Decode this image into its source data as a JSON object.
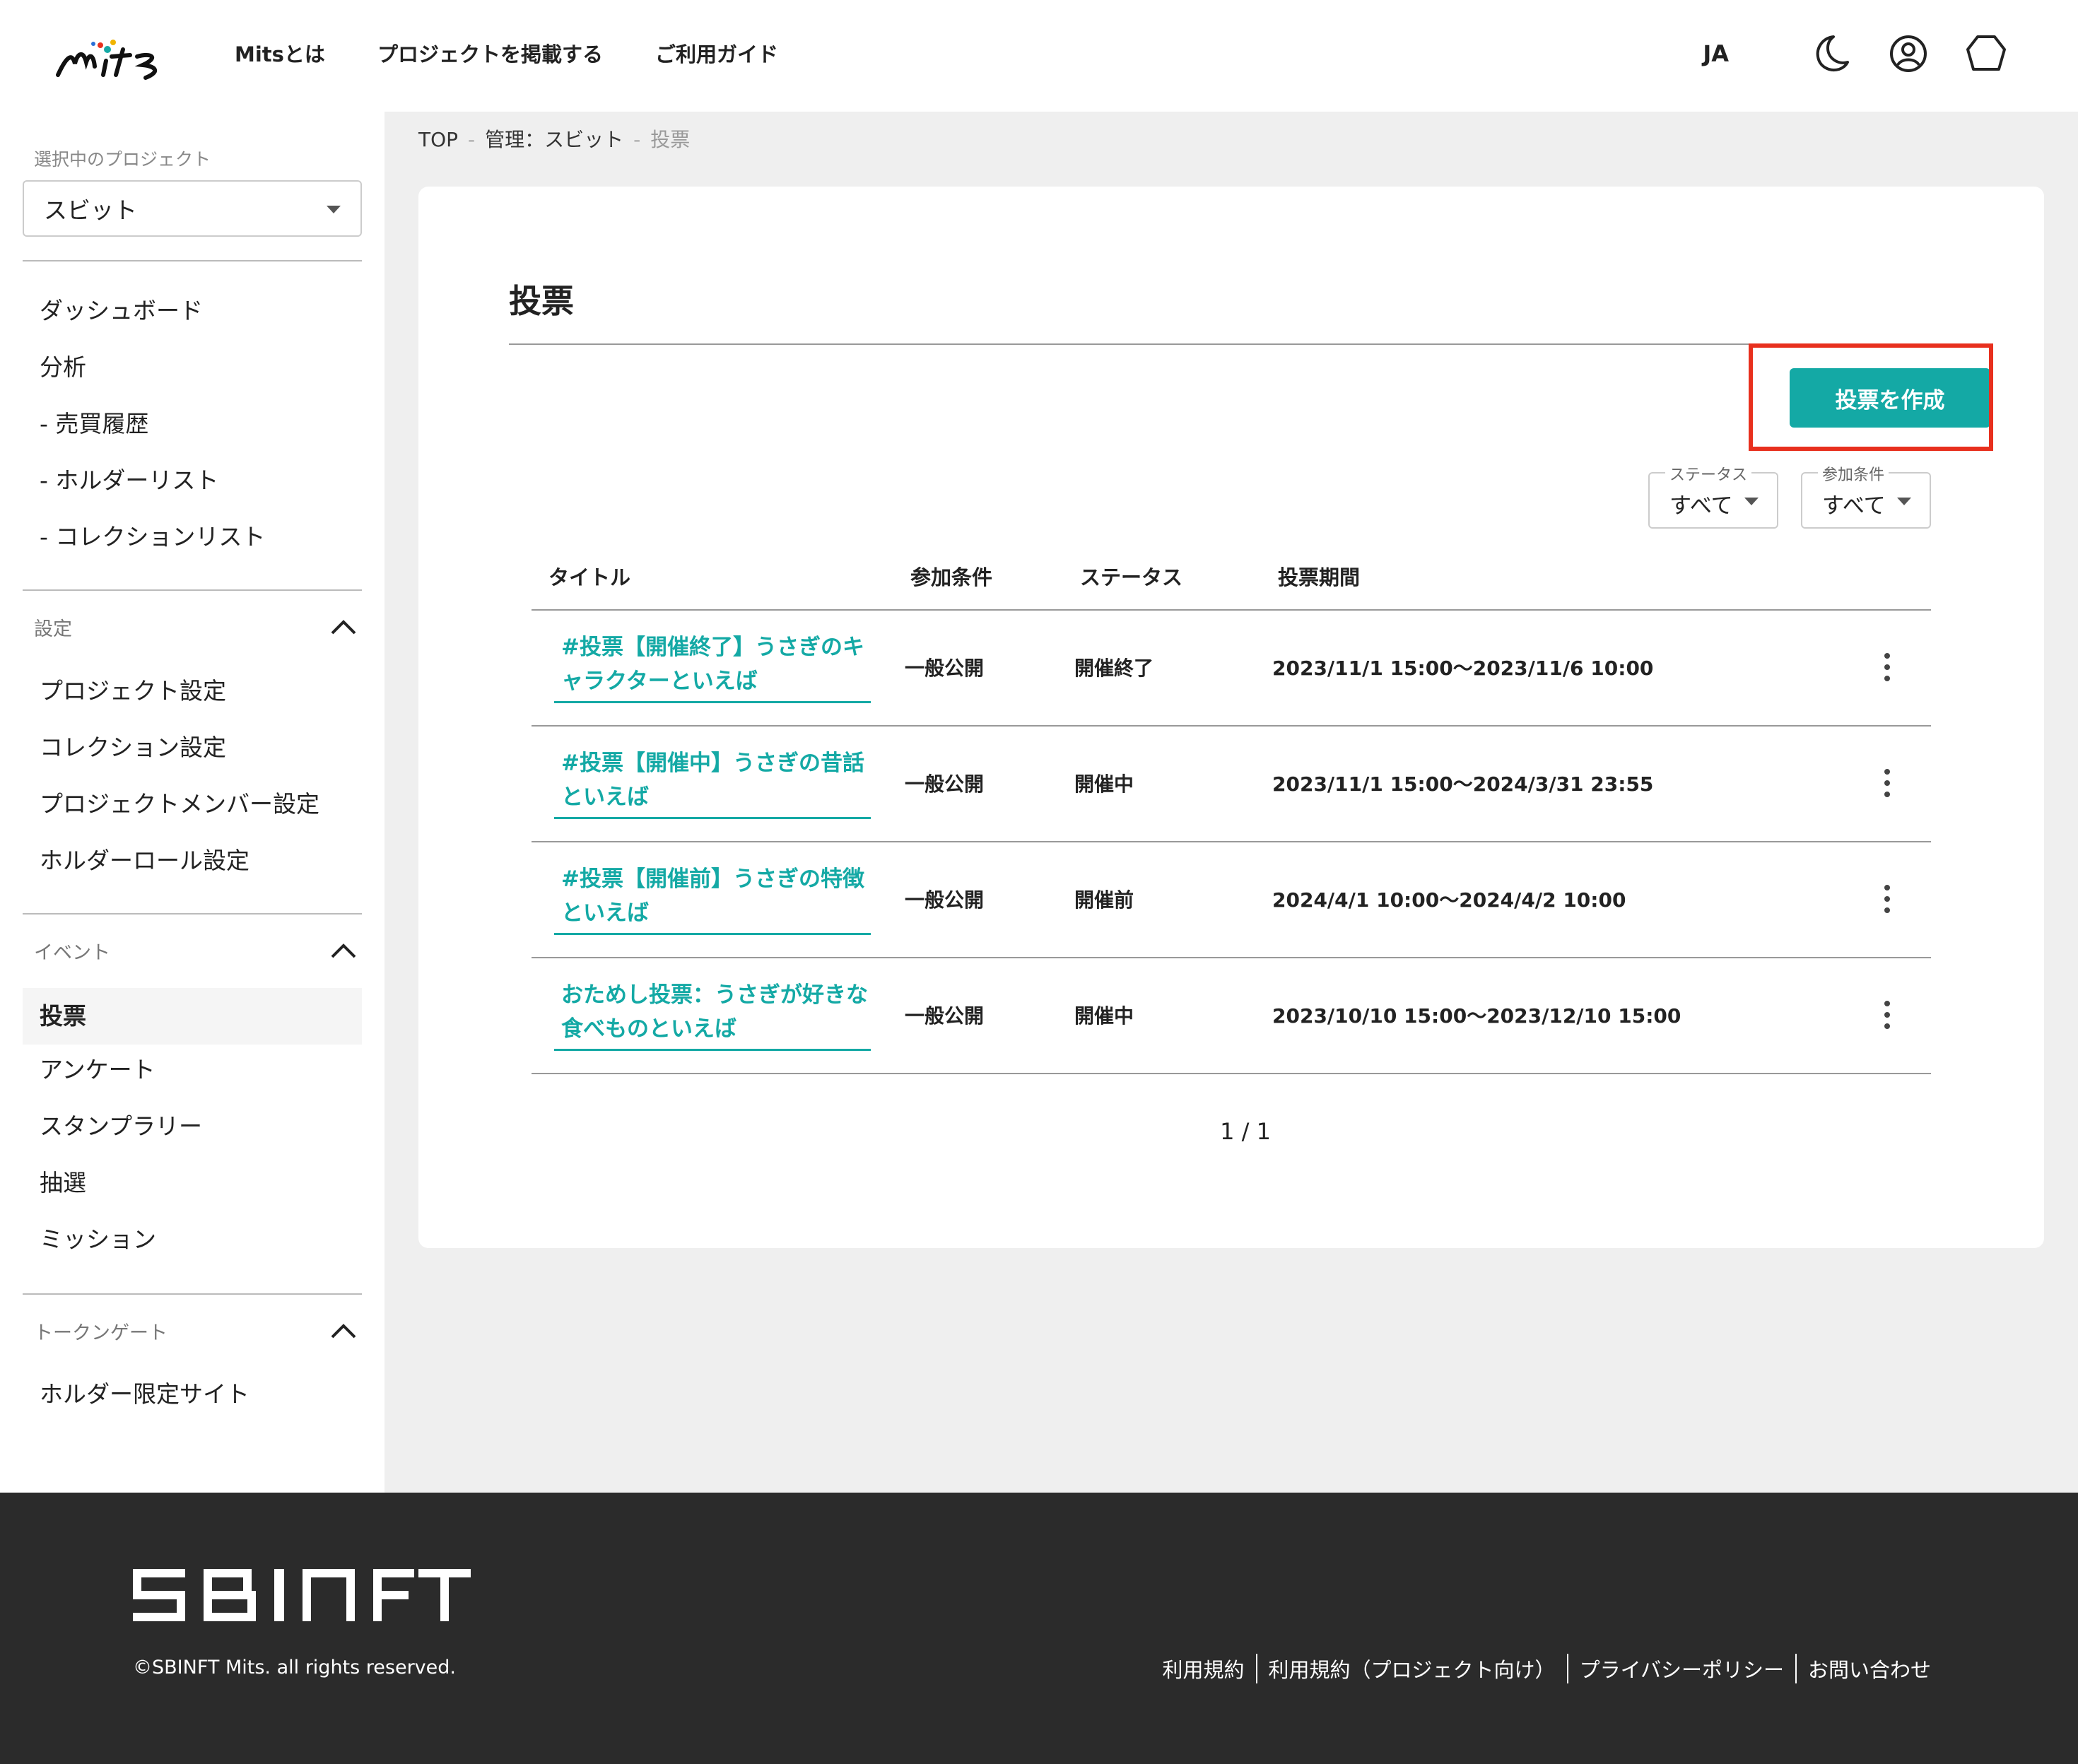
{
  "header": {
    "nav": [
      "Mitsとは",
      "プロジェクトを掲載する",
      "ご利用ガイド"
    ],
    "language": "JA",
    "icons": [
      "moon-icon",
      "account-icon",
      "wallet-hexagon-icon"
    ]
  },
  "sidebar": {
    "project_label": "選択中のプロジェクト",
    "project_value": "スビット",
    "main_items": [
      "ダッシュボード",
      "分析",
      "- 売買履歴",
      "- ホルダーリスト",
      "- コレクションリスト"
    ],
    "sections": [
      {
        "title": "設定",
        "items": [
          "プロジェクト設定",
          "コレクション設定",
          "プロジェクトメンバー設定",
          "ホルダーロール設定"
        ]
      },
      {
        "title": "イベント",
        "items": [
          "投票",
          "アンケート",
          "スタンプラリー",
          "抽選",
          "ミッション"
        ],
        "active": "投票"
      },
      {
        "title": "トークンゲート",
        "items": [
          "ホルダー限定サイト"
        ]
      }
    ]
  },
  "breadcrumb": [
    "TOP",
    "管理：スビット",
    "投票"
  ],
  "page": {
    "title": "投票",
    "create_button": "投票を作成",
    "filters": [
      {
        "label": "ステータス",
        "value": "すべて"
      },
      {
        "label": "参加条件",
        "value": "すべて"
      }
    ],
    "columns": [
      "タイトル",
      "参加条件",
      "ステータス",
      "投票期間"
    ],
    "rows": [
      {
        "title": "#投票【開催終了】うさぎのキャラクターといえば",
        "condition": "一般公開",
        "status": "開催終了",
        "period": "2023/11/1 15:00〜2023/11/6 10:00"
      },
      {
        "title": "#投票【開催中】うさぎの昔話といえば",
        "condition": "一般公開",
        "status": "開催中",
        "period": "2023/11/1 15:00〜2024/3/31 23:55"
      },
      {
        "title": "#投票【開催前】うさぎの特徴といえば",
        "condition": "一般公開",
        "status": "開催前",
        "period": "2024/4/1 10:00〜2024/4/2 10:00"
      },
      {
        "title": "おためし投票：うさぎが好きな食べものといえば",
        "condition": "一般公開",
        "status": "開催中",
        "period": "2023/10/10 15:00〜2023/12/10 15:00"
      }
    ],
    "pagination": "1 / 1"
  },
  "footer": {
    "brand": "SBINFT",
    "copyright": "©SBINFT Mits. all rights reserved.",
    "links": [
      "利用規約",
      "利用規約（プロジェクト向け）",
      "プライバシーポリシー",
      "お問い合わせ"
    ]
  },
  "colors": {
    "accent": "#14a9a5",
    "highlight": "#e8301e",
    "footer_bg": "#2b2b2b"
  }
}
